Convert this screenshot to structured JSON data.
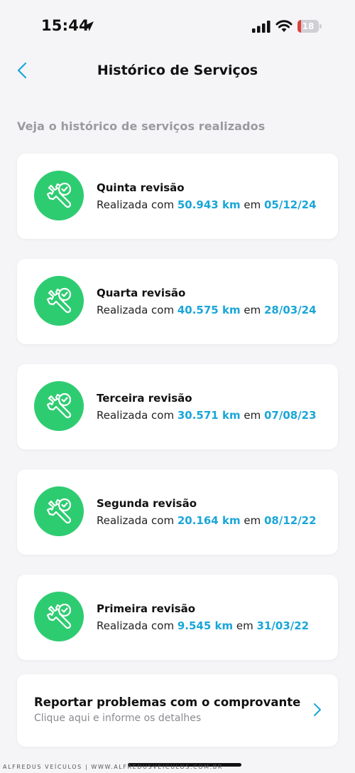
{
  "status_bar": {
    "time": "15:44",
    "battery_level": "18",
    "battery_fraction": 0.18,
    "icons": [
      "location-arrow-icon",
      "cellular-signal-icon",
      "wifi-icon",
      "battery-icon"
    ]
  },
  "header": {
    "title": "Histórico de Serviços",
    "back_icon": "chevron-left-icon"
  },
  "subtitle": "Veja o histórico de serviços realizados",
  "colors": {
    "accent": "#1aa6d8",
    "icon_bg": "#2ecc71",
    "battery_low": "#e0413a",
    "background": "#f5f5f7"
  },
  "services": [
    {
      "title": "Quinta revisão",
      "prefix": "Realizada com ",
      "km": "50.943 km",
      "middle": " em ",
      "date": "05/12/24",
      "icon": "wrench-check-icon"
    },
    {
      "title": "Quarta revisão",
      "prefix": "Realizada com ",
      "km": "40.575 km",
      "middle": " em ",
      "date": "28/03/24",
      "icon": "wrench-check-icon"
    },
    {
      "title": "Terceira revisão",
      "prefix": "Realizada com ",
      "km": "30.571 km",
      "middle": " em ",
      "date": "07/08/23",
      "icon": "wrench-check-icon"
    },
    {
      "title": "Segunda revisão",
      "prefix": "Realizada com ",
      "km": "20.164 km",
      "middle": " em ",
      "date": "08/12/22",
      "icon": "wrench-check-icon"
    },
    {
      "title": "Primeira revisão",
      "prefix": "Realizada com ",
      "km": "9.545 km",
      "middle": " em ",
      "date": "31/03/22",
      "icon": "wrench-check-icon"
    }
  ],
  "report": {
    "title": "Reportar problemas com o comprovante",
    "subtitle": "Clique aqui e informe os detalhes",
    "icon": "chevron-right-icon"
  },
  "watermark": "ALFREDUS VEÍCULOS | WWW.ALFREDUSVEICULOS.COM.BR"
}
